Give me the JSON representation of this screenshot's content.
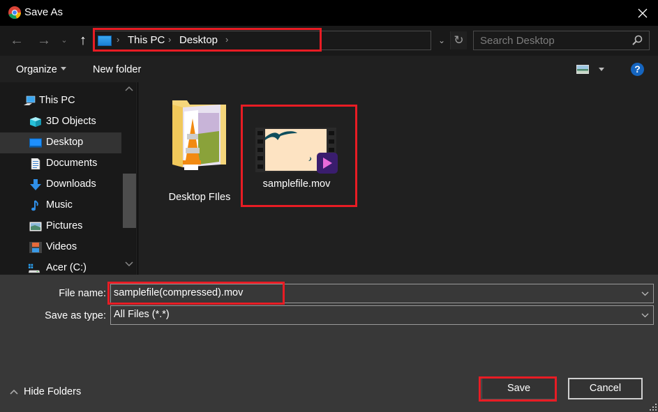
{
  "window": {
    "title": "Save As",
    "app_icon": "chrome-icon",
    "close_icon": "close-icon"
  },
  "navigation": {
    "back_icon": "arrow-left-icon",
    "forward_icon": "arrow-right-icon",
    "recent_icon": "chevron-down-icon",
    "up_icon": "arrow-up-icon",
    "breadcrumb": [
      "This PC",
      "Desktop"
    ],
    "refresh_icon": "refresh-icon",
    "search_placeholder": "Search Desktop",
    "search_value": ""
  },
  "commandbar": {
    "organize_label": "Organize",
    "new_folder_label": "New folder",
    "view_icon": "change-view-icon",
    "help_label": "?"
  },
  "sidebar": {
    "items": [
      {
        "label": "This PC",
        "icon": "this-pc-icon",
        "selected": false,
        "indent": 1
      },
      {
        "label": "3D Objects",
        "icon": "3d-objects-icon",
        "selected": false,
        "indent": 2
      },
      {
        "label": "Desktop",
        "icon": "desktop-icon",
        "selected": true,
        "indent": 2
      },
      {
        "label": "Documents",
        "icon": "documents-icon",
        "selected": false,
        "indent": 2
      },
      {
        "label": "Downloads",
        "icon": "downloads-icon",
        "selected": false,
        "indent": 2
      },
      {
        "label": "Music",
        "icon": "music-icon",
        "selected": false,
        "indent": 2
      },
      {
        "label": "Pictures",
        "icon": "pictures-icon",
        "selected": false,
        "indent": 2
      },
      {
        "label": "Videos",
        "icon": "videos-icon",
        "selected": false,
        "indent": 2
      },
      {
        "label": "Acer (C:)",
        "icon": "drive-icon",
        "selected": false,
        "indent": 2
      }
    ]
  },
  "files": [
    {
      "name": "Desktop FIles",
      "type": "folder",
      "icon": "folder-icon"
    },
    {
      "name": "samplefile.mov",
      "type": "video",
      "icon": "video-file-icon"
    }
  ],
  "form": {
    "file_name_label": "File name:",
    "file_name_value": "samplefile(compressed).mov",
    "save_as_type_label": "Save as type:",
    "save_as_type_value": "All Files (*.*)"
  },
  "footer": {
    "hide_folders_label": "Hide Folders",
    "save_label": "Save",
    "cancel_label": "Cancel"
  },
  "colors": {
    "highlight_red": "#e81c24",
    "accent_blue": "#1565c0"
  }
}
